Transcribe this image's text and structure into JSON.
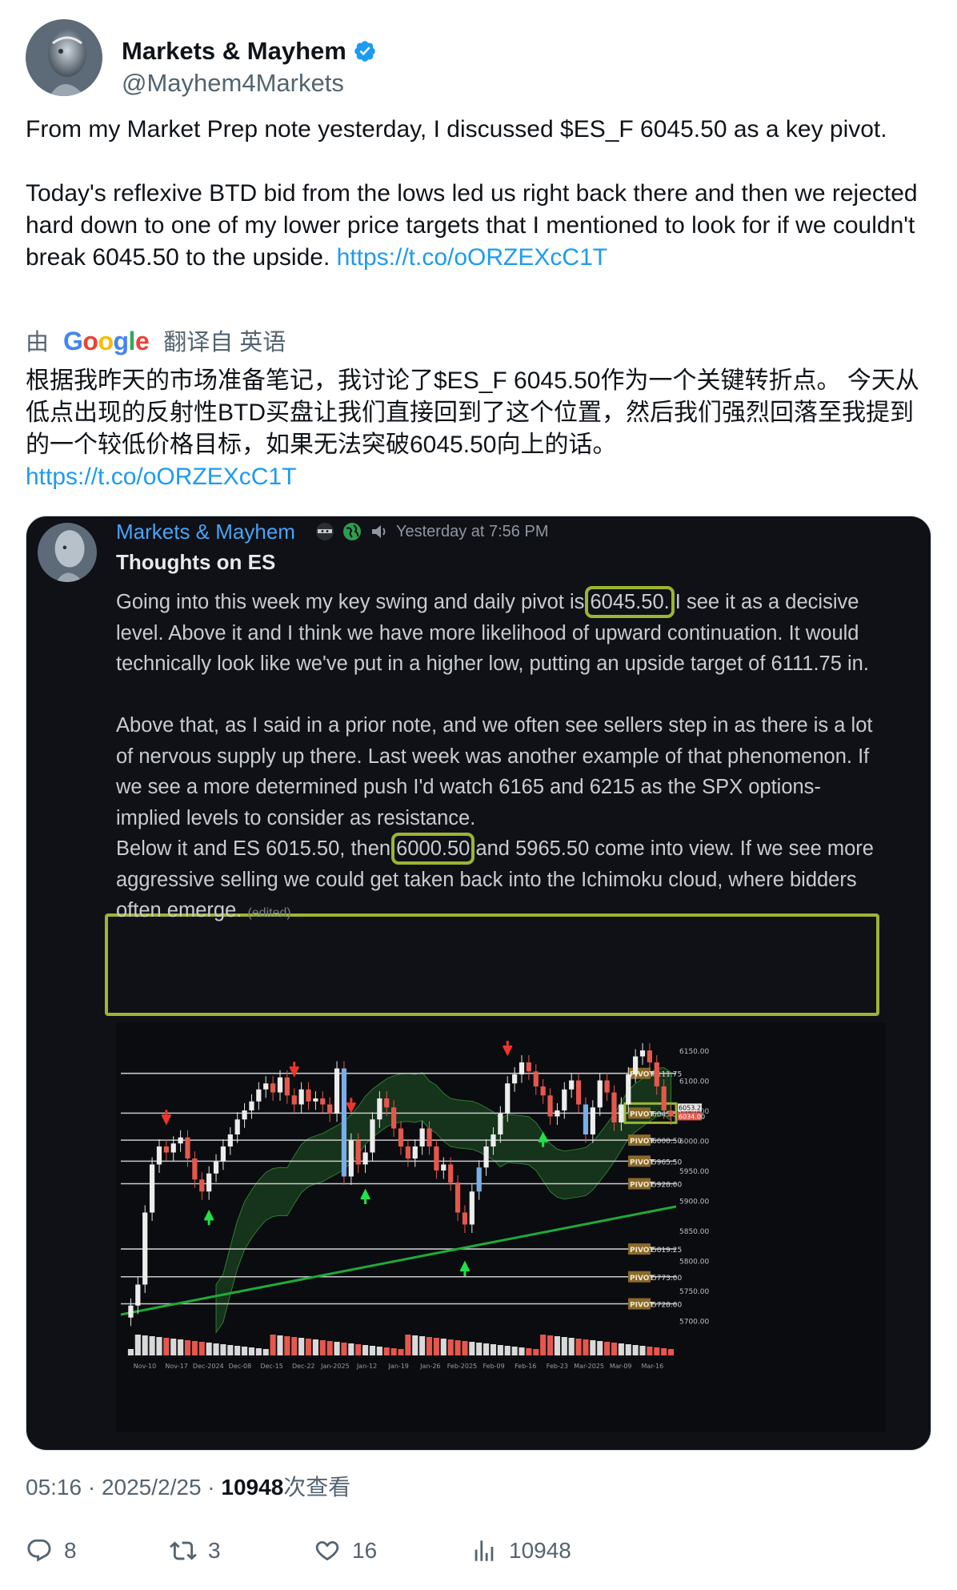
{
  "author": {
    "name": "Markets & Mayhem",
    "handle": "@Mayhem4Markets",
    "verified_color": "#1d9bf0"
  },
  "tweet": {
    "para1": "From my Market Prep note yesterday, I discussed $ES_F 6045.50 as a key pivot.",
    "para2": "Today's reflexive BTD bid from the lows led us right back there and then we rejected hard down to one of my lower price targets that I mentioned to look for if we couldn't break 6045.50 to the upside.",
    "link": "https://t.co/oORZEXcC1T"
  },
  "translation": {
    "by": "由",
    "provider": "Google",
    "label": "翻译自 英语",
    "text": "根据我昨天的市场准备笔记，我讨论了$ES_F 6045.50作为一个关键转折点。 今天从低点出现的反射性BTD买盘让我们直接回到了这个位置，然后我们强烈回落至我提到的一个较低价格目标，如果无法突破6045.50向上的话。",
    "link": "https://t.co/oORZEXcC1T"
  },
  "embedded_post": {
    "name": "Markets & Mayhem",
    "timestamp": "Yesterday at 7:56 PM",
    "title": "Thoughts on ES",
    "p1_before": "Going into this week my key swing and daily pivot is ",
    "p1_hl": "6045.50.",
    "p1_after": " I see it as a decisive level. Above it and I think we have more likelihood of upward continuation. It would technically look like we've put in a higher low, putting an upside target of 6111.75 in.",
    "p2": "Above that, as I said in a prior note, and we often see sellers step in as there is a lot of nervous supply up there. Last week was another example of that phenomenon. If we see a more determined push I'd watch 6165 and 6215 as the SPX options-implied levels to consider as resistance.",
    "p3_before": "Below it and ES 6015.50, then ",
    "p3_hl": "6000.50",
    "p3_after": " and 5965.50 come into view. If we see more aggressive selling we could get taken back into the Ichimoku cloud, where bidders often emerge. ",
    "edited": "(edited)",
    "highlight_color": "#9bb534"
  },
  "chart_data": {
    "type": "candlestick",
    "y_ticks": [
      "6150.00",
      "6100.00",
      "6050.00",
      "6000.00",
      "5950.00",
      "5900.00",
      "5850.00",
      "5800.00",
      "5750.00",
      "5700.00"
    ],
    "ylim": [
      5690,
      6170
    ],
    "x_ticks": [
      "Nov-10",
      "Nov-17",
      "Dec-2024",
      "Dec-08",
      "Dec-15",
      "Dec-22",
      "Jan-2025",
      "Jan-12",
      "Jan-19",
      "Jan-26",
      "Feb-2025",
      "Feb-09",
      "Feb-16",
      "Feb-23",
      "Mar-2025",
      "Mar-09",
      "Mar-16"
    ],
    "pivots": [
      {
        "label": "PIVOT",
        "value": 6111.75,
        "text": "6111.75"
      },
      {
        "label": "PIVOT",
        "value": 6045.5,
        "text": "6045.50"
      },
      {
        "label": "PIVOT",
        "value": 6000.5,
        "text": "6000.50"
      },
      {
        "label": "PIVOT",
        "value": 5965.5,
        "text": "5965.50"
      },
      {
        "label": "PIVOT",
        "value": 5928.0,
        "text": "5928.00"
      },
      {
        "label": "PIVOT",
        "value": 5819.25,
        "text": "5819.25"
      },
      {
        "label": "PIVOT",
        "value": 5773.0,
        "text": "5773.00"
      },
      {
        "label": "PIVOT",
        "value": 5728.0,
        "text": "5728.00"
      }
    ],
    "price_tags": [
      "6053.25",
      "6034.00"
    ],
    "closes": [
      5725,
      5760,
      5880,
      5960,
      5990,
      5980,
      5995,
      6005,
      5970,
      5935,
      5915,
      5945,
      5965,
      5990,
      6010,
      6035,
      6050,
      6065,
      6085,
      6095,
      6080,
      6105,
      6075,
      6060,
      6085,
      6065,
      6070,
      6060,
      6045,
      6120,
      5940,
      6000,
      5960,
      5980,
      6035,
      6070,
      6055,
      6020,
      5990,
      5970,
      5990,
      6020,
      5990,
      5950,
      5960,
      5930,
      5880,
      5860,
      5915,
      5955,
      5990,
      6010,
      6045,
      6095,
      6110,
      6130,
      6115,
      6090,
      6075,
      6040,
      6050,
      6085,
      6100,
      6060,
      6010,
      6055,
      6100,
      6080,
      6030,
      6060,
      6110,
      6140,
      6150,
      6130,
      6090,
      6050,
      6040
    ],
    "ichimoku_cloud": true,
    "trendline": [
      5710,
      5890
    ],
    "arrows_up": [
      11,
      33,
      47,
      58
    ],
    "arrows_down": [
      5,
      23,
      31,
      53
    ]
  },
  "footer": {
    "time": "05:16 · 2025/2/25 · ",
    "views_count": "10948",
    "views_label": "次查看"
  },
  "actions": {
    "replies": "8",
    "retweets": "3",
    "likes": "16",
    "views": "10948"
  }
}
